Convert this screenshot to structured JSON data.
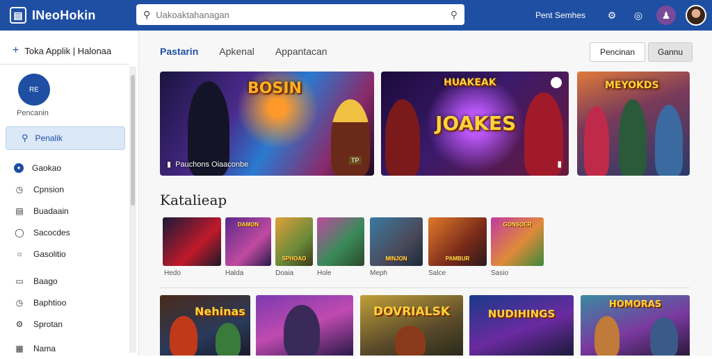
{
  "header": {
    "app_name": "INeoHokin",
    "search_placeholder": "Uakoaktahanagan",
    "link": "Pent Semhes"
  },
  "sidebar": {
    "title": "Toka Applik | Halonaa",
    "profile_badge": "RE",
    "profile_label": "Pencanin",
    "active_item": "Penalik",
    "items": [
      {
        "label": "Gaokao",
        "icon": "globe-icon"
      },
      {
        "label": "Cpnsion",
        "icon": "clock-icon"
      },
      {
        "label": "Buadaain",
        "icon": "bag-icon"
      },
      {
        "label": "Sacocdes",
        "icon": "timer-icon"
      },
      {
        "label": "Gasolitio",
        "icon": "circle-icon"
      },
      {
        "label": "Baago",
        "icon": "box-icon"
      },
      {
        "label": "Baphtioo",
        "icon": "clock-icon"
      },
      {
        "label": "Sprotan",
        "icon": "gear-icon"
      },
      {
        "label": "Nama",
        "icon": "doc-icon"
      }
    ]
  },
  "main": {
    "tabs": [
      "Pastarin",
      "Apkenal",
      "Appantacan"
    ],
    "action_primary": "Pencinan",
    "action_secondary": "Gannu",
    "banners": [
      {
        "title": "BOSIN",
        "caption": "Pauchons Oiaaconbe",
        "badge": "TP"
      },
      {
        "title": "JOAKES",
        "subtitle": "HUAKEAK",
        "caption": ""
      },
      {
        "title": "MEYOKDS",
        "caption": ""
      }
    ],
    "section_title": "Katalieap",
    "thumbs": [
      {
        "label": ""
      },
      {
        "label": "DAMON"
      },
      {
        "label": "SPHOAO"
      },
      {
        "label": ""
      },
      {
        "label": "MINJON"
      },
      {
        "label": "PAMBUR"
      },
      {
        "label": "GONSOER"
      }
    ],
    "categories": [
      "Hedo",
      "Halda",
      "Doaia",
      "Hole",
      "Meph",
      "Salce",
      "Sasio"
    ],
    "cards": [
      {
        "title": "Nehinas"
      },
      {
        "title": ""
      },
      {
        "title": "DOVRIALSK"
      },
      {
        "title": "NUDIHINGS"
      },
      {
        "title": "HOMORAS"
      }
    ]
  },
  "colors": {
    "brand": "#1f4fa3",
    "active_bg": "#dbe8f8",
    "title_gold": "#ffd23a"
  }
}
